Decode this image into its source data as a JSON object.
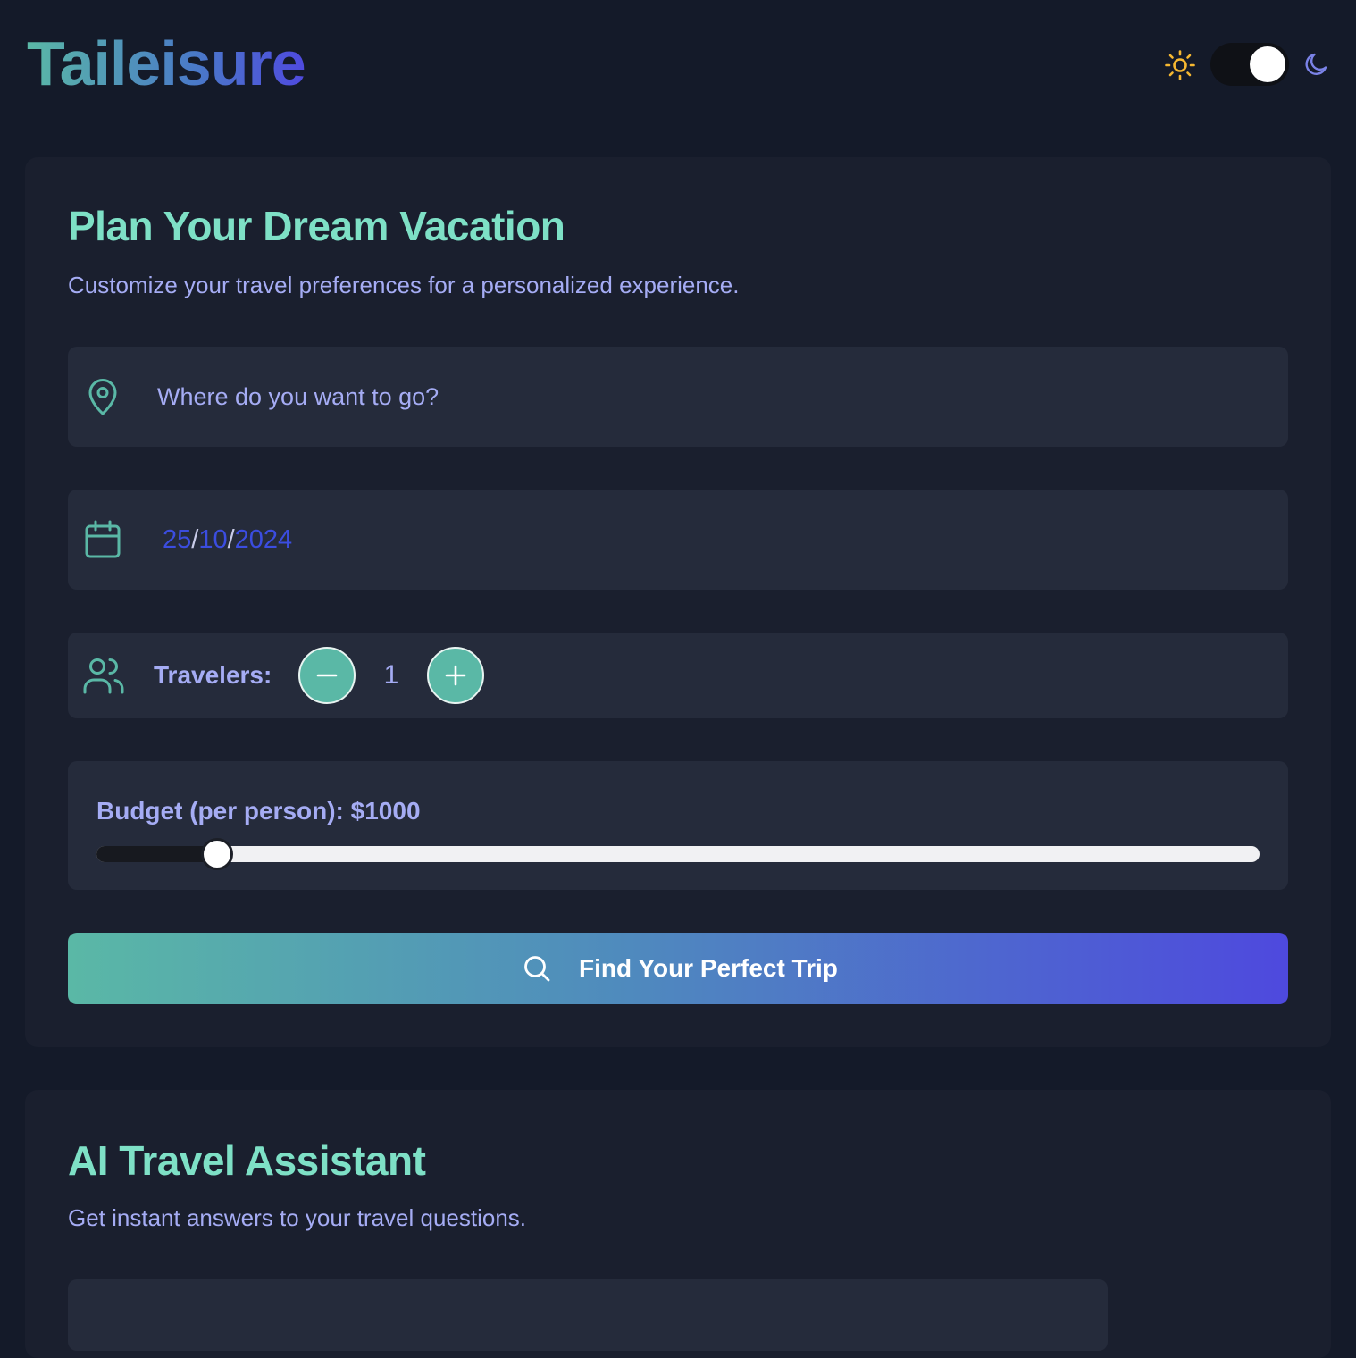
{
  "app": {
    "name": "Taileisure"
  },
  "theme": {
    "mode": "dark",
    "icons": [
      "sun-icon",
      "moon-icon"
    ]
  },
  "planner": {
    "title": "Plan Your Dream Vacation",
    "subtitle": "Customize your travel preferences for a personalized experience.",
    "destination": {
      "placeholder": "Where do you want to go?",
      "icon": "map-pin-icon"
    },
    "date": {
      "day": "25",
      "month": "10",
      "year": "2024",
      "separator": "/",
      "icon": "calendar-icon"
    },
    "travelers": {
      "label": "Travelers:",
      "count": "1",
      "icon": "users-icon"
    },
    "budget": {
      "label": "Budget (per person): $1000",
      "fill_fraction": 0.104
    },
    "search_button": {
      "label": "Find Your Perfect Trip",
      "icon": "search-icon"
    }
  },
  "assistant": {
    "title": "AI Travel Assistant",
    "subtitle": "Get instant answers to your travel questions."
  },
  "colors": {
    "background": "#141a29",
    "card": "#1a1f2e",
    "field": "#252b3b",
    "accent_teal": "#5ab8a6",
    "accent_indigo": "#4f4adf",
    "heading": "#7ee0c6",
    "text": "#a5acf4"
  }
}
